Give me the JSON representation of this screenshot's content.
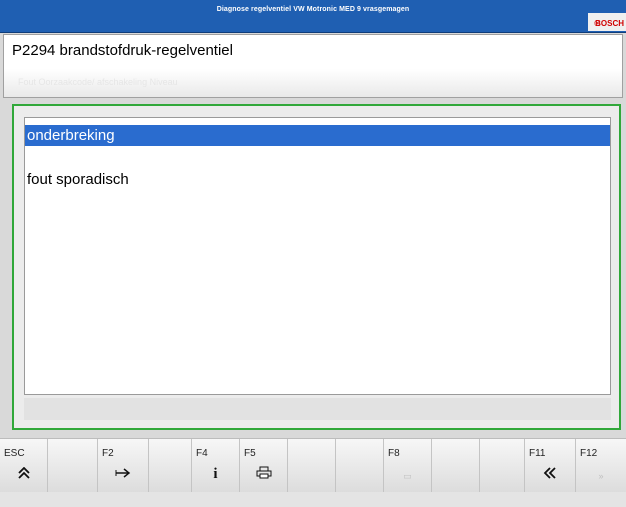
{
  "window": {
    "title": "Diagnose regelventiel VW Motronic MED 9 vrasgemagen",
    "brand": "BOSCH"
  },
  "header": {
    "code_title": "P2294  brandstofdruk-regelventiel",
    "subtitle": "Fout   Oorzaakcode/ afschakeling Niveau"
  },
  "fault_list": {
    "items": [
      {
        "label": "onderbreking",
        "selected": true
      },
      {
        "label": "fout sporadisch",
        "selected": false
      }
    ]
  },
  "function_keys": [
    {
      "key": "ESC",
      "icon": "double-chevron-up-icon",
      "glyph": "≈"
    },
    {
      "key": "",
      "icon": "",
      "glyph": ""
    },
    {
      "key": "F2",
      "icon": "arrow-right-icon",
      "glyph": "⇾"
    },
    {
      "key": "",
      "icon": "",
      "glyph": ""
    },
    {
      "key": "F4",
      "icon": "info-icon",
      "glyph": "i"
    },
    {
      "key": "F5",
      "icon": "print-icon",
      "glyph": "⎙"
    },
    {
      "key": "",
      "icon": "",
      "glyph": ""
    },
    {
      "key": "",
      "icon": "",
      "glyph": ""
    },
    {
      "key": "F8",
      "icon": "disabled-icon",
      "glyph": "▭"
    },
    {
      "key": "",
      "icon": "",
      "glyph": ""
    },
    {
      "key": "",
      "icon": "",
      "glyph": ""
    },
    {
      "key": "F11",
      "icon": "double-chevron-left-icon",
      "glyph": "«"
    },
    {
      "key": "F12",
      "icon": "disabled-icon",
      "glyph": "»"
    }
  ]
}
